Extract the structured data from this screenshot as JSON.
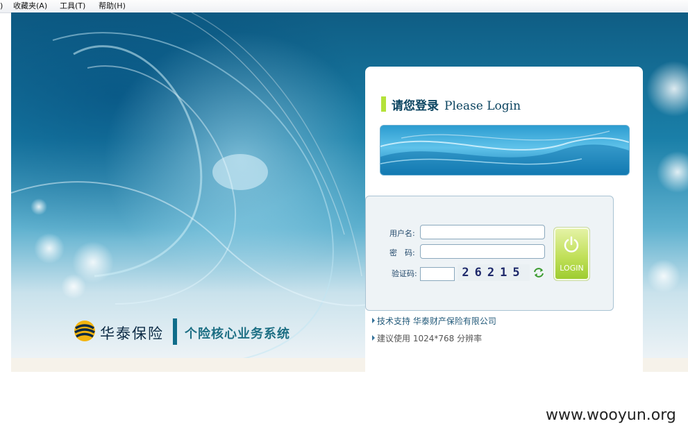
{
  "menu": {
    "favorites": "收藏夹(A)",
    "tools": "工具(T)",
    "help": "帮助(H)"
  },
  "brand": {
    "company": "华泰保险",
    "system_name": "个险核心业务系统"
  },
  "login": {
    "title_cn": "请您登录",
    "title_en": "Please Login",
    "username_label": "用户名:",
    "password_label": "密　码:",
    "captcha_label": "验证码:",
    "username_value": "",
    "password_value": "",
    "captcha_value": "",
    "captcha_image_text": "26215",
    "login_button": "LOGIN"
  },
  "footer_info": {
    "tech_support": "技术支持 华泰财产保险有限公司",
    "resolution": "建议使用 1024*768 分辨率"
  },
  "watermark": "www.wooyun.org",
  "colors": {
    "accent_green": "#b4e23a",
    "title_text": "#0b4460",
    "banner_blue": "#1a7fa8"
  }
}
